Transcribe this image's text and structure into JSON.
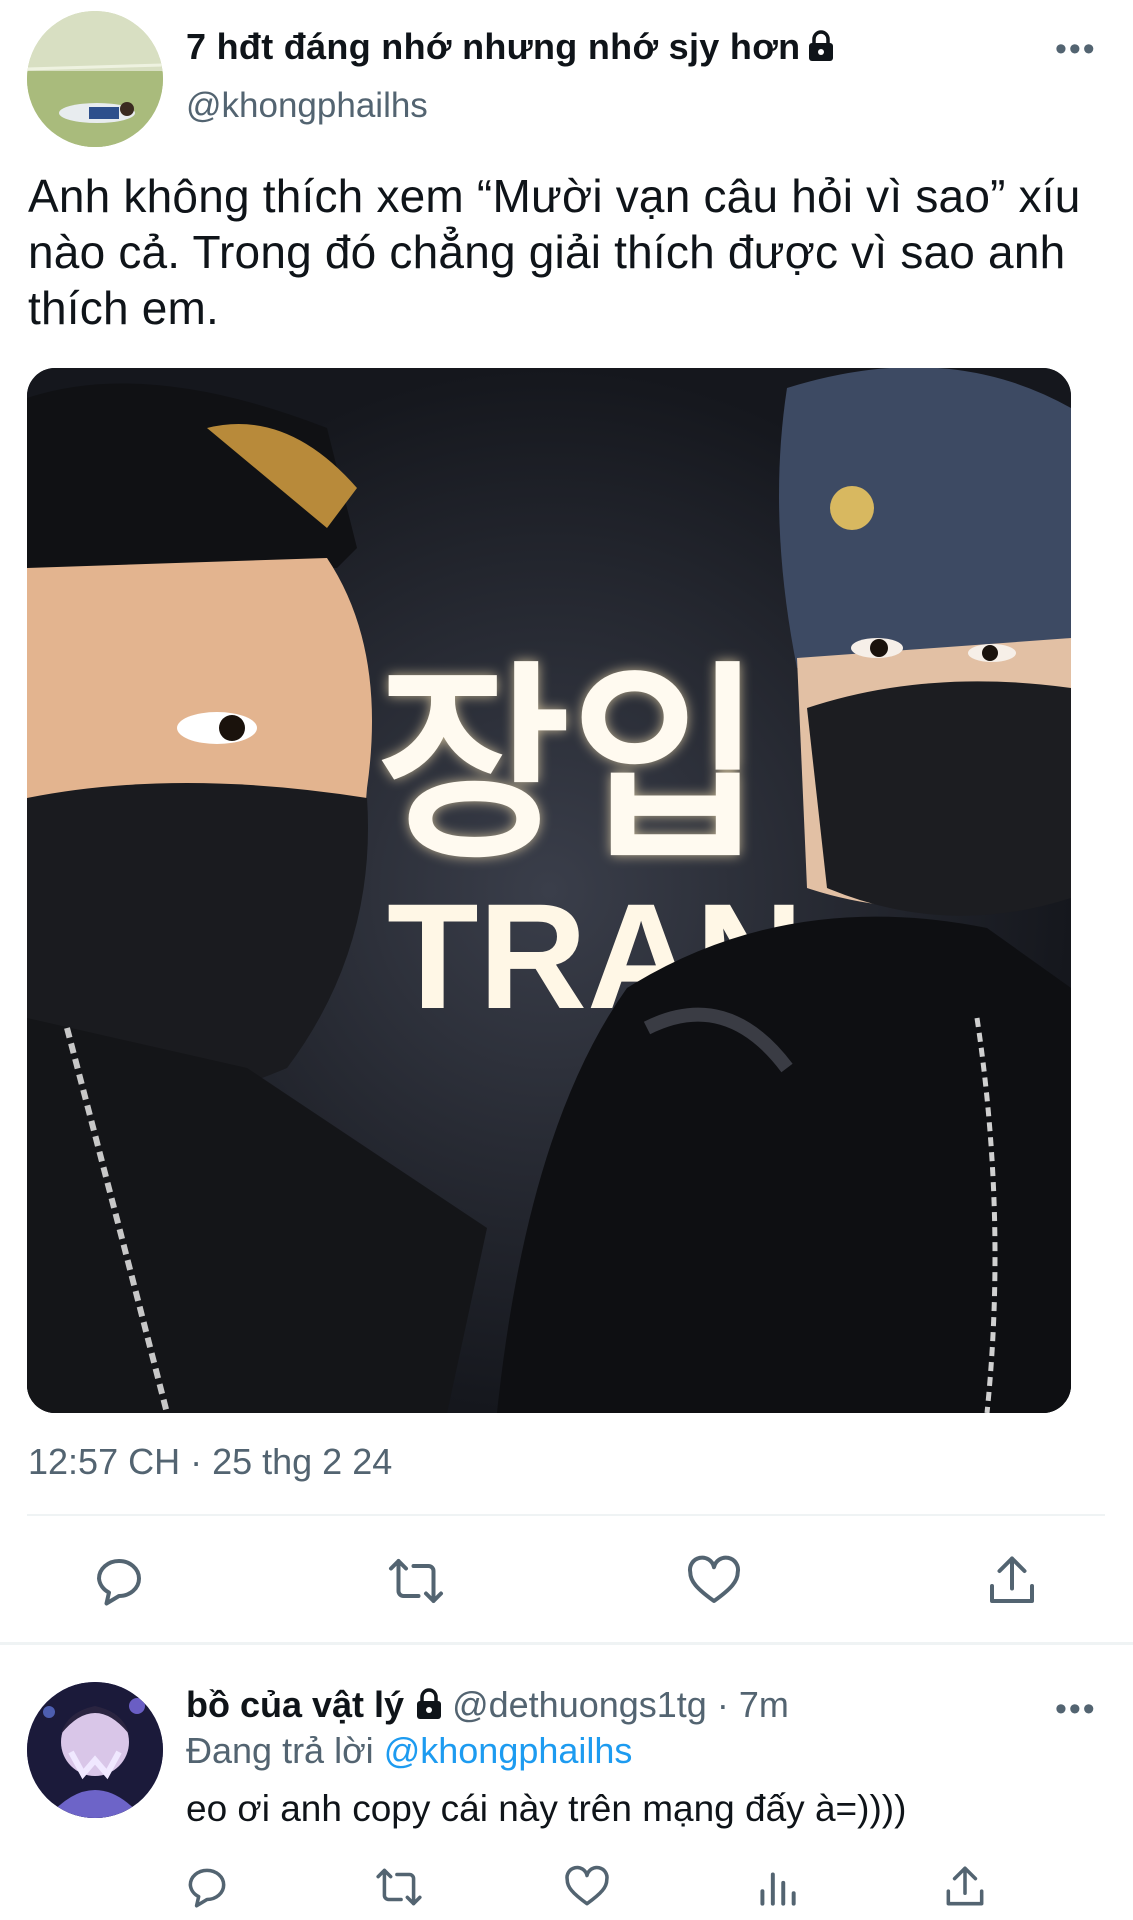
{
  "tweet": {
    "author_name": "7 hđt đáng nhớ nhưng nhớ sjy hơn",
    "author_handle": "@khongphailhs",
    "text": "Anh không thích xem “Mười vạn câu hỏi vì sao” xíu nào cả. Trong đó chẳng giải thích được vì sao anh thích em.",
    "timestamp": "12:57 CH · 25 thg 2 24",
    "media": {
      "sign_korean": "장입",
      "sign_english": "TRAN"
    },
    "icons": [
      "lock-icon",
      "more-icon",
      "reply-icon",
      "retweet-icon",
      "like-icon",
      "share-icon"
    ]
  },
  "reply": {
    "author_name": "bồ của vật lý",
    "author_handle": "@dethuongs1tg · 7m",
    "replying_prefix": "Đang trả lời",
    "replying_to": "@khongphailhs",
    "text": "eo ơi anh copy cái này trên mạng đấy à=))))",
    "icons": [
      "lock-icon",
      "more-icon",
      "reply-icon",
      "retweet-icon",
      "like-icon",
      "views-icon",
      "share-icon"
    ]
  },
  "colors": {
    "text": "#0f1419",
    "secondary": "#536471",
    "link": "#1d9bf0",
    "divider": "#eff3f4"
  }
}
